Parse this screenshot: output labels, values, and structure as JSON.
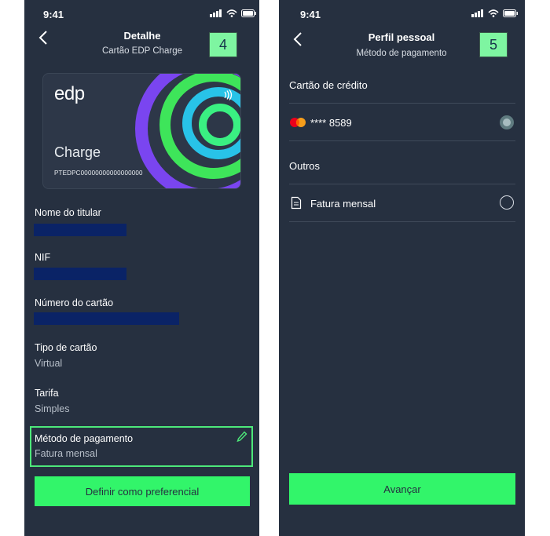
{
  "screen1": {
    "time": "9:41",
    "header": {
      "title": "Detalhe",
      "subtitle": "Cartão EDP Charge"
    },
    "step_badge": "4",
    "card": {
      "logo": "edp",
      "name": "Charge",
      "number": "PTEDPC00000000000000000"
    },
    "fields": [
      {
        "label": "Nome do titular",
        "value": ""
      },
      {
        "label": "NIF",
        "value": ""
      },
      {
        "label": "Número do cartão",
        "value": ""
      },
      {
        "label": "Tipo de cartão",
        "value": "Virtual"
      },
      {
        "label": "Tarifa",
        "value": "Simples"
      },
      {
        "label": "Método de pagamento",
        "value": "Fatura mensal"
      }
    ],
    "primary_button": "Definir como preferencial"
  },
  "screen2": {
    "time": "9:41",
    "header": {
      "title": "Perfil pessoal",
      "subtitle": "Método de pagamento"
    },
    "step_badge": "5",
    "section_credit": "Cartão de crédito",
    "card_option": {
      "label": "**** 8589",
      "selected": true
    },
    "section_other": "Outros",
    "invoice_option": {
      "label": "Fatura mensal",
      "selected": false
    },
    "primary_button": "Avançar"
  },
  "colors": {
    "background": "#263040",
    "accent_green": "#32f56a",
    "badge": "#7ef5a1",
    "redaction": "#0a2366",
    "selection_border": "#4de87a"
  }
}
